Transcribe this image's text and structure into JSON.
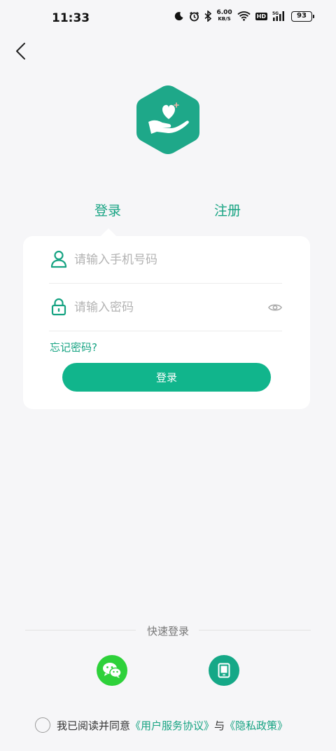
{
  "status_bar": {
    "time": "11:33",
    "net_speed_value": "6.00",
    "net_speed_unit": "KB/S",
    "hd_badge": "HD",
    "signal_label": "5G",
    "battery": "93",
    "icons": [
      "moon-icon",
      "alarm-icon",
      "bluetooth-icon",
      "wifi-icon",
      "signal-icon",
      "battery-icon"
    ]
  },
  "nav": {
    "back_icon": "chevron-left-icon"
  },
  "logo": {
    "icon": "heart-hand-icon",
    "color": "#1ea889"
  },
  "tabs": {
    "login": "登录",
    "register": "注册"
  },
  "form": {
    "phone_placeholder": "请输入手机号码",
    "phone_value": "",
    "password_placeholder": "请输入密码",
    "password_value": "",
    "forgot_password": "忘记密码?",
    "login_button": "登录"
  },
  "quick_login": {
    "label": "快速登录",
    "options": [
      {
        "icon": "wechat-icon",
        "color": "#2ed13a"
      },
      {
        "icon": "tablet-icon",
        "color": "#15a887"
      }
    ]
  },
  "agreement": {
    "prefix": "我已阅读并同意",
    "service_link": "《用户服务协议》",
    "conjunction": "与",
    "privacy_link": "《隐私政策》",
    "checked": false
  },
  "colors": {
    "accent": "#16a382",
    "button": "#11b58c",
    "background": "#f6f6f8"
  }
}
